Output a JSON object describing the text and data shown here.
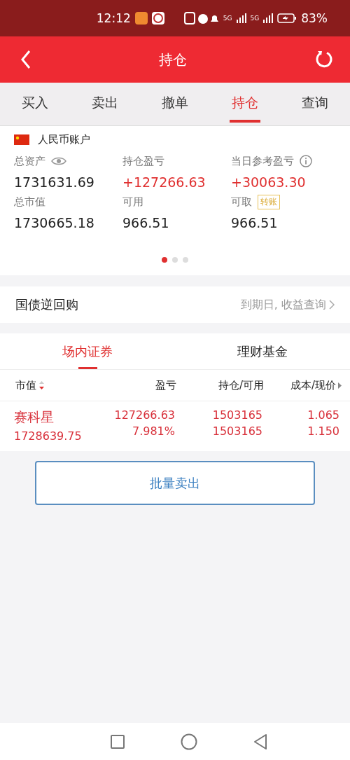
{
  "status_bar": {
    "time": "12:12",
    "signal_1": "5G",
    "signal_2": "5G",
    "battery": "83%"
  },
  "header": {
    "title": "持仓"
  },
  "tabs": [
    {
      "label": "买入",
      "selected": false
    },
    {
      "label": "卖出",
      "selected": false
    },
    {
      "label": "撤单",
      "selected": false
    },
    {
      "label": "持仓",
      "selected": true
    },
    {
      "label": "查询",
      "selected": false
    }
  ],
  "account": {
    "name": "人民币账户",
    "stats": [
      {
        "label": "总资产",
        "value": "1731631.69",
        "kind": "eye",
        "positive": false
      },
      {
        "label": "持仓盈亏",
        "value": "+127266.63",
        "kind": "none",
        "positive": true
      },
      {
        "label": "当日参考盈亏",
        "value": "+30063.30",
        "kind": "info",
        "positive": true
      },
      {
        "label": "总市值",
        "value": "1730665.18",
        "kind": "none",
        "positive": false
      },
      {
        "label": "可用",
        "value": "966.51",
        "kind": "none",
        "positive": false
      },
      {
        "label": "可取",
        "value": "966.51",
        "kind": "transfer",
        "action": "转账",
        "positive": false
      }
    ],
    "pages": [
      {
        "selected": true
      },
      {
        "selected": false
      },
      {
        "selected": false
      }
    ]
  },
  "repo": {
    "title": "国债逆回购",
    "link": "到期日, 收益查询"
  },
  "holding_tabs": [
    {
      "label": "场内证券",
      "selected": true
    },
    {
      "label": "理财基金",
      "selected": false
    }
  ],
  "table": {
    "columns": [
      "市值",
      "盈亏",
      "持仓/可用",
      "成本/现价"
    ],
    "rows": [
      {
        "cells": [
          [
            "赛科星",
            "1728639.75"
          ],
          [
            "127266.63",
            "7.981%"
          ],
          [
            "1503165",
            "1503165"
          ],
          [
            "1.065",
            "1.150"
          ]
        ]
      }
    ]
  },
  "batch_sell": "批量卖出"
}
